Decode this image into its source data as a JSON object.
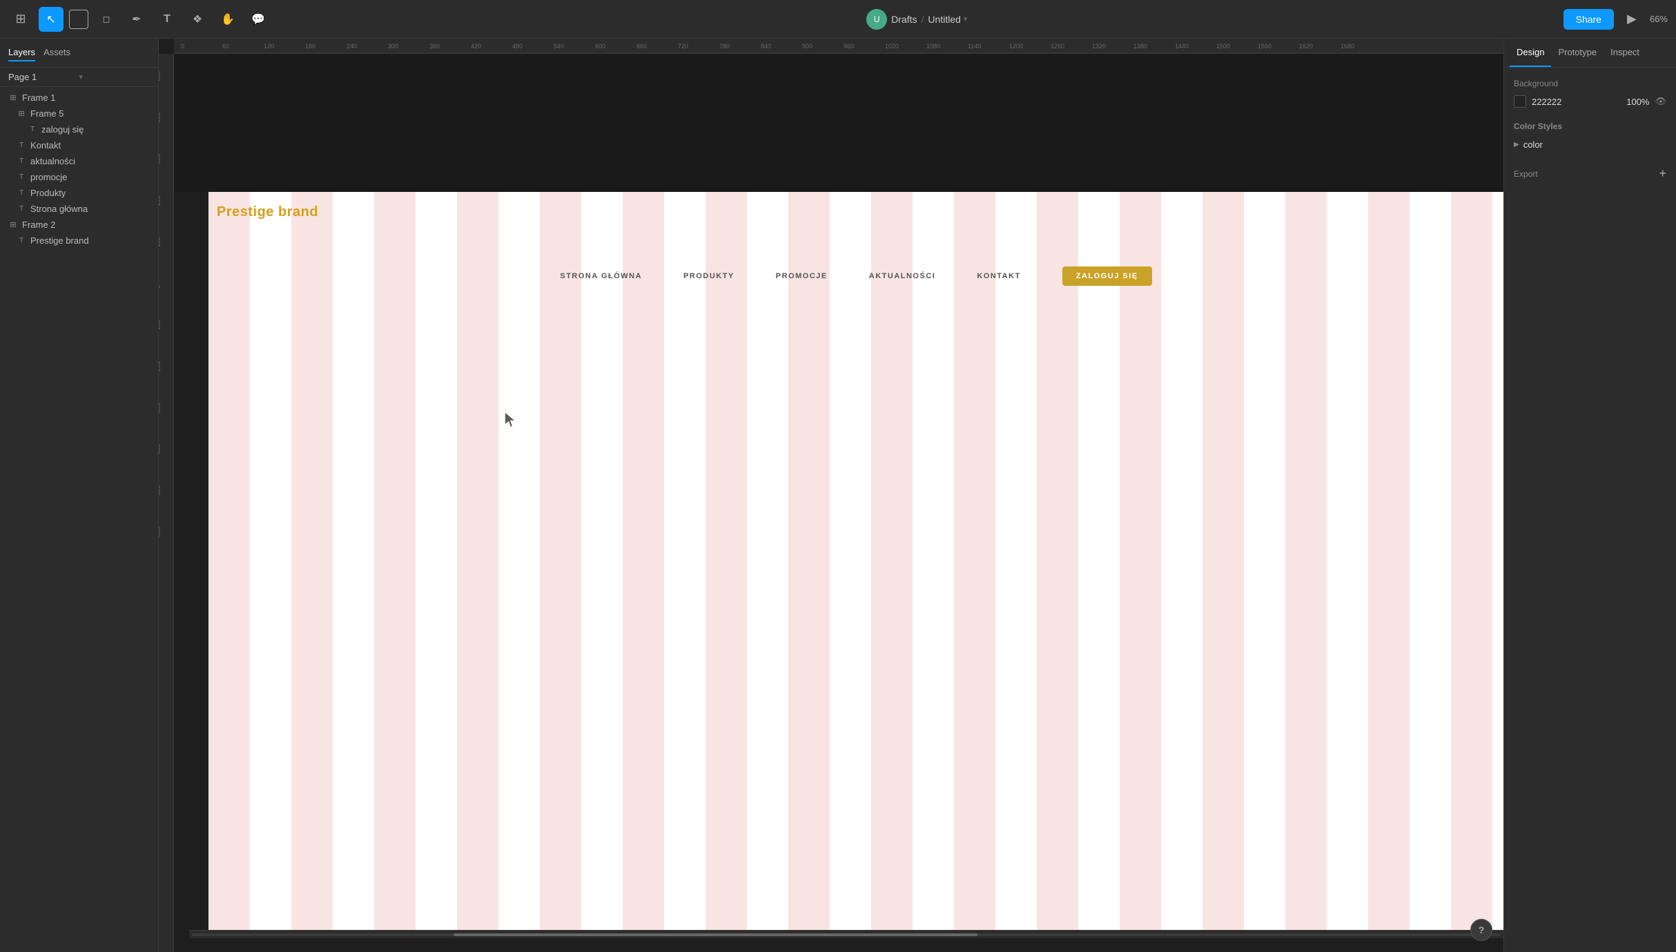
{
  "toolbar": {
    "tools": [
      {
        "name": "main-menu",
        "icon": "⊞",
        "active": false
      },
      {
        "name": "select-tool",
        "icon": "↖",
        "active": true
      },
      {
        "name": "frame-tool",
        "icon": "⬚",
        "active": false
      },
      {
        "name": "shape-tool",
        "icon": "◻",
        "active": false
      },
      {
        "name": "pen-tool",
        "icon": "✒",
        "active": false
      },
      {
        "name": "text-tool",
        "icon": "T",
        "active": false
      },
      {
        "name": "components-tool",
        "icon": "❖",
        "active": false
      },
      {
        "name": "hand-tool",
        "icon": "✋",
        "active": false
      },
      {
        "name": "comment-tool",
        "icon": "💬",
        "active": false
      }
    ],
    "breadcrumb": {
      "drafts": "Drafts",
      "separator": "/",
      "title": "Untitled"
    },
    "share_label": "Share",
    "zoom_label": "66%"
  },
  "sidebar": {
    "tabs": [
      {
        "name": "layers-tab",
        "label": "Layers",
        "active": true
      },
      {
        "name": "assets-tab",
        "label": "Assets",
        "active": false
      }
    ],
    "page_label": "Page 1",
    "layers": [
      {
        "id": "frame1",
        "label": "Frame 1",
        "icon": "⊞",
        "indent": 0,
        "type": "frame"
      },
      {
        "id": "frame5",
        "label": "Frame 5",
        "icon": "⊞",
        "indent": 1,
        "type": "frame"
      },
      {
        "id": "zaloguj",
        "label": "zaloguj się",
        "icon": "T",
        "indent": 2,
        "type": "text"
      },
      {
        "id": "kontakt",
        "label": "Kontakt",
        "icon": "T",
        "indent": 1,
        "type": "text"
      },
      {
        "id": "aktualnosci",
        "label": "aktualności",
        "icon": "T",
        "indent": 1,
        "type": "text"
      },
      {
        "id": "promocje",
        "label": "promocje",
        "icon": "T",
        "indent": 1,
        "type": "text"
      },
      {
        "id": "produkty",
        "label": "Produkty",
        "icon": "T",
        "indent": 1,
        "type": "text"
      },
      {
        "id": "strona",
        "label": "Strona główna",
        "icon": "T",
        "indent": 1,
        "type": "text"
      },
      {
        "id": "frame2",
        "label": "Frame 2",
        "icon": "⊞",
        "indent": 0,
        "type": "frame"
      },
      {
        "id": "prestige",
        "label": "Prestige brand",
        "icon": "T",
        "indent": 1,
        "type": "text"
      }
    ]
  },
  "canvas": {
    "background_color": "#1e1e1e",
    "artboard": {
      "prestige_brand_label": "Prestige brand",
      "nav_items": [
        {
          "label": "STRONA GŁÓWNA"
        },
        {
          "label": "PRODUKTY"
        },
        {
          "label": "PROMOCJE"
        },
        {
          "label": "AKTUALNOŚCI"
        },
        {
          "label": "KONTAKT"
        }
      ],
      "cta_button_label": "ZALOGUJ SIĘ"
    }
  },
  "right_panel": {
    "tabs": [
      {
        "name": "design-tab",
        "label": "Design",
        "active": true
      },
      {
        "name": "prototype-tab",
        "label": "Prototype",
        "active": false
      },
      {
        "name": "inspect-tab",
        "label": "Inspect",
        "active": false
      }
    ],
    "background": {
      "label": "Background",
      "color_hex": "222222",
      "color_swatch": "#222222",
      "opacity": "100%"
    },
    "color_styles": {
      "label": "Color Styles",
      "group": {
        "arrow": "▶",
        "name": "color"
      }
    },
    "export": {
      "label": "Export",
      "add_icon": "+"
    }
  },
  "help": {
    "label": "?"
  }
}
